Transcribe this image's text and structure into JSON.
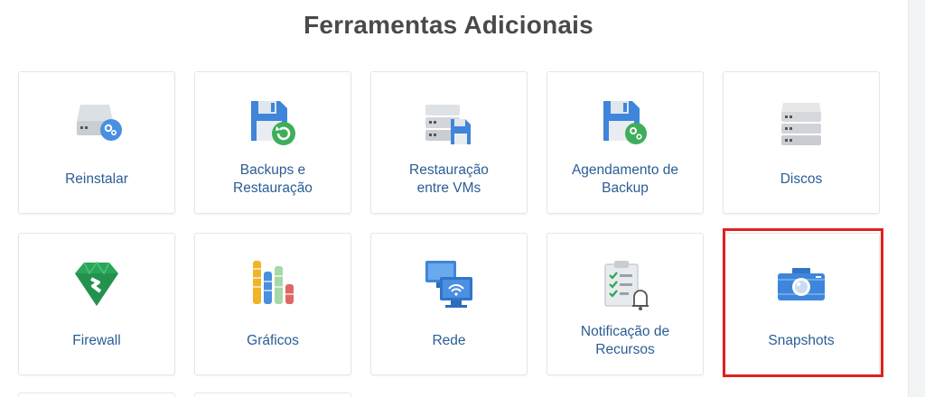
{
  "section": {
    "title": "Ferramentas Adicionais"
  },
  "tools": [
    {
      "id": "reinstalar",
      "label": "Reinstalar",
      "icon": "server-gear-icon"
    },
    {
      "id": "backups",
      "label": "Backups e\nRestauração",
      "icon": "floppy-restore-icon"
    },
    {
      "id": "restauracao-vms",
      "label": "Restauração\nentre VMs",
      "icon": "server-floppy-icon"
    },
    {
      "id": "agendamento",
      "label": "Agendamento de\nBackup",
      "icon": "floppy-gear-icon"
    },
    {
      "id": "discos",
      "label": "Discos",
      "icon": "disk-stack-icon"
    },
    {
      "id": "firewall",
      "label": "Firewall",
      "icon": "firewall-gem-icon"
    },
    {
      "id": "graficos",
      "label": "Gráficos",
      "icon": "bar-chart-icon"
    },
    {
      "id": "rede",
      "label": "Rede",
      "icon": "network-monitor-icon"
    },
    {
      "id": "notificacao",
      "label": "Notificação de\nRecursos",
      "icon": "checklist-bell-icon"
    },
    {
      "id": "snapshots",
      "label": "Snapshots",
      "icon": "camera-icon"
    }
  ],
  "highlighted_tool": "snapshots",
  "colors": {
    "label": "#2a5d95",
    "title": "#4a4a4a",
    "highlight": "#e02020"
  }
}
